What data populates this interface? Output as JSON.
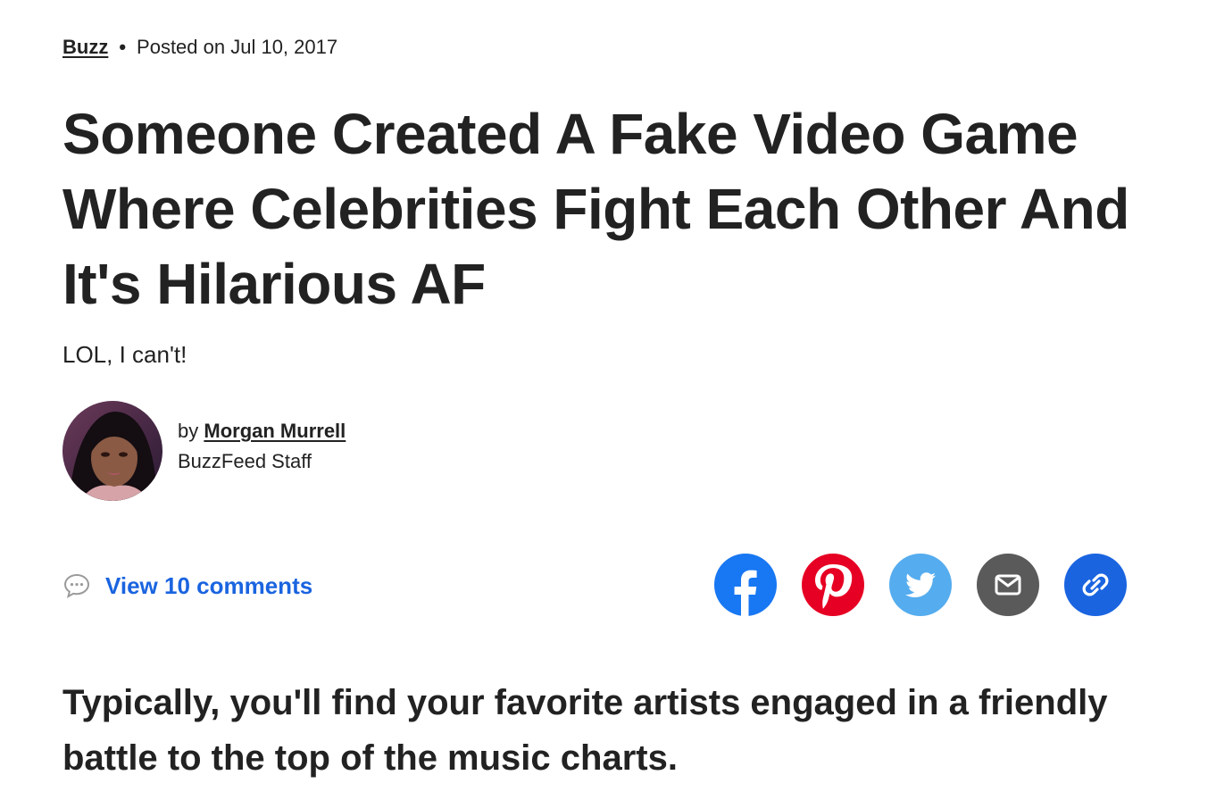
{
  "meta": {
    "category": "Buzz",
    "separator": "•",
    "posted": "Posted on Jul 10, 2017"
  },
  "headline": "Someone Created A Fake Video Game Where Celebrities Fight Each Other And It's Hilarious AF",
  "dek": "LOL, I can't!",
  "byline": {
    "prefix": "by",
    "author": "Morgan Murrell",
    "role": "BuzzFeed Staff",
    "avatar_icon": "author-photo"
  },
  "comments": {
    "label": "View 10 comments",
    "icon": "speech-bubble-icon",
    "color": "#1a64e0"
  },
  "share": [
    {
      "name": "facebook",
      "icon": "facebook-icon",
      "color": "#1877f2"
    },
    {
      "name": "pinterest",
      "icon": "pinterest-icon",
      "color": "#e60023"
    },
    {
      "name": "twitter",
      "icon": "twitter-icon",
      "color": "#55acee"
    },
    {
      "name": "email",
      "icon": "mail-icon",
      "color": "#5a5a5a"
    },
    {
      "name": "copy-link",
      "icon": "link-icon",
      "color": "#1a64e0"
    }
  ],
  "intro": "Typically, you'll find your favorite artists engaged in a friendly battle to the top of the music charts."
}
